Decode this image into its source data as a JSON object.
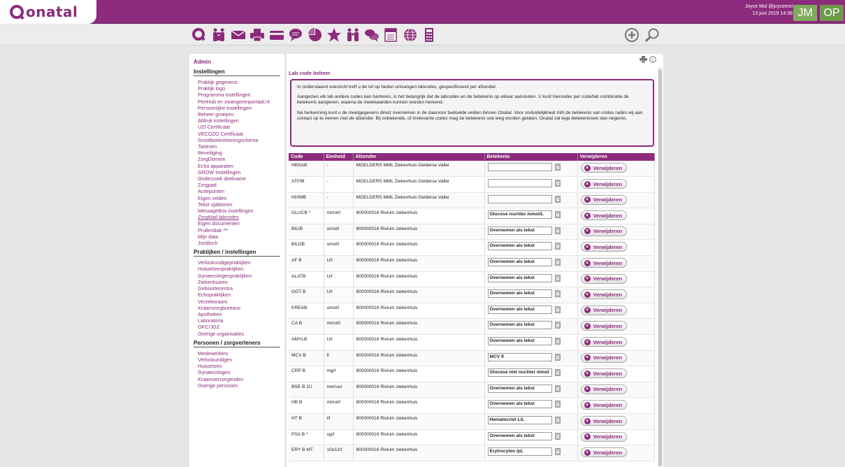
{
  "header": {
    "logo_text": "onatal",
    "user_line1": "Joyce Mol @joycemol",
    "user_line2": "13 juni 2019 14:38",
    "badge1": "JM",
    "badge2": "OP"
  },
  "sidebar": {
    "admin_title": "Admin",
    "sections": [
      {
        "heading": "Instellingen",
        "items": [
          "Praktijk gegevens",
          "Praktijk logo",
          "Programma instellingen",
          "PeriHub en zwangerenportaal.nl",
          "Persoonlijke instellingen",
          "Beheer groepen",
          "Afdruk instellingen",
          "UZI Certificaat",
          "VECOZO Certificaat",
          "Grootboekrekeningschema",
          "Tarieven",
          "Beveiliging",
          "ZorgDomein",
          "Echo apparaten",
          "GROW Instellingen",
          "Onderzoek deelname",
          "Zorgpad",
          "Actiepunten",
          "Eigen velden",
          "Tekst sjablonen",
          "MessageBox instellingen",
          "ZorgMail labcodes",
          "Eigen documenten",
          "Prullenbak ™",
          "Mijn data",
          "Juridisch"
        ]
      },
      {
        "heading": "Praktijken / instellingen",
        "items": [
          "Verloskundigepraktijken",
          "Huisartsenpraktijken",
          "Gynaecologenpraktijken",
          "Ziekenhuizen",
          "Geboortecentra",
          "Echopraktijken",
          "Verzekeraars",
          "Kraamzorgbureaus",
          "Apotheken",
          "Laboratoria",
          "OKC/JGZ",
          "Overige organisaties"
        ]
      },
      {
        "heading": "Personen / zorgverleners",
        "items": [
          "Medewerkers",
          "Verloskundigen",
          "Huisartsen",
          "Gynaecologen",
          "Kraamverzorgenden",
          "Overige personen"
        ]
      }
    ]
  },
  "main": {
    "title": "Lab code beheer",
    "intro": [
      "In onderstaand overzicht treft u de tot op heden ontvangen labcodes, gespecificeerd per afzender.",
      "Aangezien elk lab andere codes kan hanteren, is het belangrijk dat de labcodes en de betekenis op elkaar aansluiten. U kunt hieronder per code/lab combinatie de betekenis aangeven, waarna de meetwaarden kunnen worden herkend.",
      "Na herkenning kunt u de meetgegevens direct overnemen in de daarvoor bedoelde velden binnen Onatal. Voor onduidelijkheid mbt de betekenis van codes raden wij aan contact op te nemen met de afzender. Bij onbekende, of irrelevante codes mag de betekenis ook leeg worden gelaten. Onatal zal lege betekenissen dan negeren."
    ],
    "table": {
      "headers": [
        "Code",
        "Eenheid",
        "Afzender",
        "Betekenis",
        "Verwijderen"
      ],
      "delete_label": "Verwijderen",
      "rows": [
        {
          "code": "HBSAB",
          "unit": "-",
          "sender": "MGELDERS MML Ziekenhuis Gelderse Vallei",
          "meaning": ""
        },
        {
          "code": "ATPIB",
          "unit": "-",
          "sender": "MGELDERS MML Ziekenhuis Gelderse Vallei",
          "meaning": ""
        },
        {
          "code": "HIVMB",
          "unit": "-",
          "sender": "MGELDERS MML Ziekenhuis Gelderse Vallei",
          "meaning": ""
        },
        {
          "code": "GLUCB *",
          "unit": "mmol/l",
          "sender": "800000016 Rivium ziekenhuis",
          "meaning": "Glucose nuchter mmol/L"
        },
        {
          "code": "BILIB",
          "unit": "umol/l",
          "sender": "800000016 Rivium ziekenhuis",
          "meaning": "Overnemen als tekst"
        },
        {
          "code": "BILDB",
          "unit": "umol/l",
          "sender": "800000016 Rivium ziekenhuis",
          "meaning": "Overnemen als tekst"
        },
        {
          "code": "AF B",
          "unit": "U/l",
          "sender": "800000016 Rivium ziekenhuis",
          "meaning": "Overnemen als tekst"
        },
        {
          "code": "ALATB",
          "unit": "U/l",
          "sender": "800000016 Rivium ziekenhuis",
          "meaning": "Overnemen als tekst"
        },
        {
          "code": "GGT B",
          "unit": "U/l",
          "sender": "800000016 Rivium ziekenhuis",
          "meaning": "Overnemen als tekst"
        },
        {
          "code": "KREAB",
          "unit": "umol/l",
          "sender": "800000016 Rivium ziekenhuis",
          "meaning": "Overnemen als tekst"
        },
        {
          "code": "CA B",
          "unit": "mmol/l",
          "sender": "800000016 Rivium ziekenhuis",
          "meaning": "Overnemen als tekst"
        },
        {
          "code": "AMYLB",
          "unit": "U/l",
          "sender": "800000016 Rivium ziekenhuis",
          "meaning": "Overnemen als tekst"
        },
        {
          "code": "MCV B",
          "unit": "fl",
          "sender": "800000016 Rivium ziekenhuis",
          "meaning": "MCV fl"
        },
        {
          "code": "CRP B",
          "unit": "mg/l",
          "sender": "800000016 Rivium ziekenhuis",
          "meaning": "Glucose niet nuchter mmol"
        },
        {
          "code": "BSE B 1U",
          "unit": "mm/uur",
          "sender": "800000016 Rivium ziekenhuis",
          "meaning": "Overnemen als tekst"
        },
        {
          "code": "HB B",
          "unit": "mmol/l",
          "sender": "800000016 Rivium ziekenhuis",
          "meaning": "Overnemen als tekst"
        },
        {
          "code": "HT B",
          "unit": "l/l",
          "sender": "800000016 Rivium ziekenhuis",
          "meaning": "Hematocriet L/L"
        },
        {
          "code": "PSA B *",
          "unit": "ug/l",
          "sender": "800000016 Rivium ziekenhuis",
          "meaning": "Overnemen als tekst"
        },
        {
          "code": "ERY B MT",
          "unit": "10e12/l",
          "sender": "800000016 Rivium ziekenhuis",
          "meaning": "Erytrocyten /pL"
        }
      ]
    }
  },
  "colors": {
    "brand": "#8c2a7c",
    "badge_green": "#7fab5c"
  },
  "nav_icons": [
    "onatal-home-icon",
    "family-icon",
    "mail-icon",
    "printer-icon",
    "card-icon",
    "chat-bubble-icon",
    "pie-chart-icon",
    "star-icon",
    "people-icon",
    "conversation-icon",
    "calendar-icon",
    "globe-icon",
    "calculator-icon",
    "add-circle-icon",
    "search-icon"
  ]
}
